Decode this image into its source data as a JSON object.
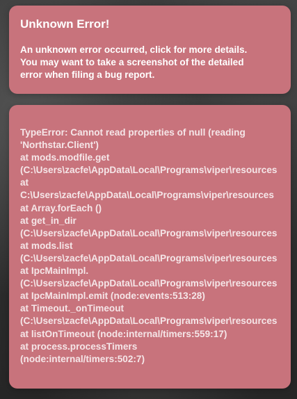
{
  "error_toast": {
    "title": "Unknown Error!",
    "message_lines": [
      "An unknown error occurred, click for more details.",
      "You may want to take a screenshot of the detailed",
      "error when filing a bug report."
    ]
  },
  "details_toast": {
    "lines": [
      "TypeError: Cannot read properties of null (reading",
      "'Northstar.Client')",
      "at mods.modfile.get",
      "(C:\\Users\\zacfe\\AppData\\Local\\Programs\\viper\\resources",
      "at",
      "C:\\Users\\zacfe\\AppData\\Local\\Programs\\viper\\resources",
      "at Array.forEach ()",
      "at get_in_dir",
      "(C:\\Users\\zacfe\\AppData\\Local\\Programs\\viper\\resources",
      "at mods.list",
      "(C:\\Users\\zacfe\\AppData\\Local\\Programs\\viper\\resources",
      "at IpcMainImpl.",
      "(C:\\Users\\zacfe\\AppData\\Local\\Programs\\viper\\resources",
      "at IpcMainImpl.emit (node:events:513:28)",
      "at Timeout._onTimeout",
      "(C:\\Users\\zacfe\\AppData\\Local\\Programs\\viper\\resources",
      "at listOnTimeout (node:internal/timers:559:17)",
      "at process.processTimers",
      "(node:internal/timers:502:7)"
    ]
  },
  "colors": {
    "toast_background": "#c8737c",
    "text": "#ffffff"
  }
}
